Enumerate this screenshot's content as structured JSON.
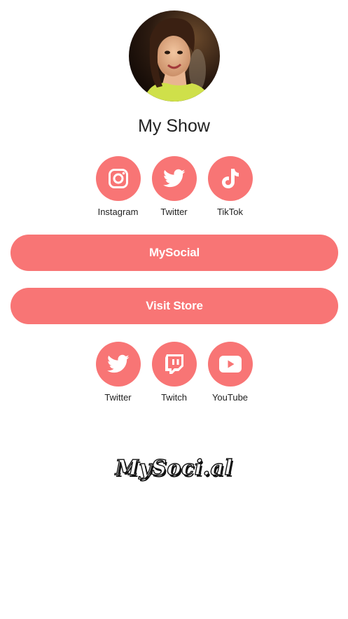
{
  "colors": {
    "accent": "#F87575",
    "text": "#222222",
    "background": "#FFFFFF"
  },
  "profile": {
    "title": "My Show"
  },
  "top_socials": [
    {
      "label": "Instagram",
      "icon": "instagram-icon"
    },
    {
      "label": "Twitter",
      "icon": "twitter-icon"
    },
    {
      "label": "TikTok",
      "icon": "tiktok-icon"
    }
  ],
  "links": [
    {
      "label": "MySocial"
    },
    {
      "label": "Visit Store"
    }
  ],
  "bottom_socials": [
    {
      "label": "Twitter",
      "icon": "twitter-icon"
    },
    {
      "label": "Twitch",
      "icon": "twitch-icon"
    },
    {
      "label": "YouTube",
      "icon": "youtube-icon"
    }
  ],
  "footer": {
    "logo_text": "MySoci.al"
  }
}
